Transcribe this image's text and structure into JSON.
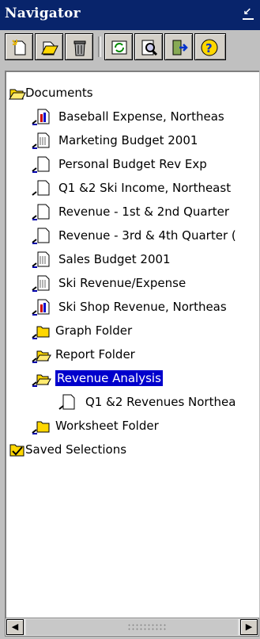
{
  "window": {
    "title": "Navigator",
    "dock_icon": "dock-arrow-icon"
  },
  "toolbar": {
    "buttons": [
      {
        "name": "new-document-button",
        "icon": "new-document-icon"
      },
      {
        "name": "open-button",
        "icon": "open-document-icon"
      },
      {
        "name": "delete-button",
        "icon": "trash-icon"
      },
      {
        "name": "refresh-button",
        "icon": "refresh-icon"
      },
      {
        "name": "find-button",
        "icon": "magnifier-icon"
      },
      {
        "name": "exit-button",
        "icon": "exit-door-icon"
      },
      {
        "name": "help-button",
        "icon": "help-icon"
      }
    ]
  },
  "tree": {
    "documents": {
      "label": "Documents"
    },
    "doc_items": [
      {
        "label": "Baseball Expense, Northeas",
        "icon": "colored-doc-icon"
      },
      {
        "label": "Marketing Budget 2001",
        "icon": "doc-icon"
      },
      {
        "label": "Personal Budget Rev Exp",
        "icon": "doc-icon"
      },
      {
        "label": "Q1 &2 Ski Income, Northeast",
        "icon": "doc-icon"
      },
      {
        "label": "Revenue - 1st & 2nd Quarter",
        "icon": "doc-icon"
      },
      {
        "label": "Revenue - 3rd & 4th Quarter (",
        "icon": "doc-icon"
      },
      {
        "label": "Sales Budget 2001",
        "icon": "doc-icon"
      },
      {
        "label": "Ski Revenue/Expense",
        "icon": "doc-icon"
      },
      {
        "label": "Ski Shop Revenue, Northeas",
        "icon": "colored-doc-icon"
      }
    ],
    "folders": [
      {
        "label": "Graph Folder"
      },
      {
        "label": "Report Folder"
      },
      {
        "label": "Revenue Analysis",
        "selected": true
      },
      {
        "label": "Q1 &2 Revenues Northea",
        "child": true
      },
      {
        "label": "Worksheet Folder"
      }
    ],
    "saved": {
      "label": "Saved Selections"
    }
  },
  "colors": {
    "title_bg": "#08246b",
    "selection": "#0000cc",
    "folder_yellow": "#ffd700"
  }
}
